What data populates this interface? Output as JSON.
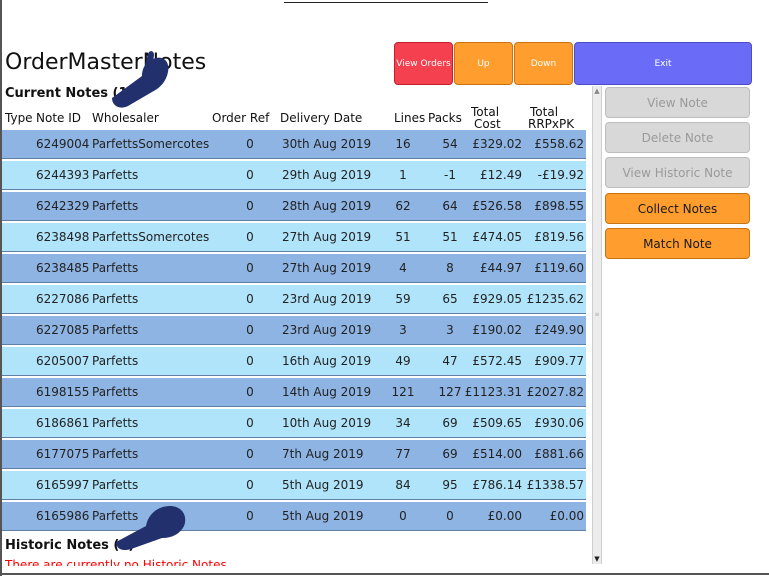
{
  "app": {
    "title": "OrderMasterNotes"
  },
  "toolbar": {
    "view_orders": "View Orders",
    "up": "Up",
    "down": "Down",
    "exit": "Exit"
  },
  "sections": {
    "current": "Current Notes (13)",
    "historic": "Historic Notes (0)",
    "historic_message": "There are currently no Historic Notes"
  },
  "table": {
    "headers": {
      "type": "Type",
      "note_id": "Note ID",
      "wholesaler": "Wholesaler",
      "order_ref": "Order Ref",
      "delivery_date": "Delivery Date",
      "lines": "Lines",
      "packs": "Packs",
      "total_cost_1": "Total",
      "total_cost_2": "Cost",
      "total_rrp_1": "Total",
      "total_rrp_2": "RRPxPK"
    },
    "rows": [
      {
        "note_id": "6249004",
        "wholesaler": "ParfettsSomercotes",
        "order_ref": "0",
        "delivery_date": "30th Aug 2019",
        "lines": "16",
        "packs": "54",
        "total_cost": "£329.02",
        "total_rrp": "£558.62"
      },
      {
        "note_id": "6244393",
        "wholesaler": "Parfetts",
        "order_ref": "0",
        "delivery_date": "29th Aug 2019",
        "lines": "1",
        "packs": "-1",
        "total_cost": "£12.49",
        "total_rrp": "-£19.92"
      },
      {
        "note_id": "6242329",
        "wholesaler": "Parfetts",
        "order_ref": "0",
        "delivery_date": "28th Aug 2019",
        "lines": "62",
        "packs": "64",
        "total_cost": "£526.58",
        "total_rrp": "£898.55"
      },
      {
        "note_id": "6238498",
        "wholesaler": "ParfettsSomercotes",
        "order_ref": "0",
        "delivery_date": "27th Aug 2019",
        "lines": "51",
        "packs": "51",
        "total_cost": "£474.05",
        "total_rrp": "£819.56"
      },
      {
        "note_id": "6238485",
        "wholesaler": "Parfetts",
        "order_ref": "0",
        "delivery_date": "27th Aug 2019",
        "lines": "4",
        "packs": "8",
        "total_cost": "£44.97",
        "total_rrp": "£119.60"
      },
      {
        "note_id": "6227086",
        "wholesaler": "Parfetts",
        "order_ref": "0",
        "delivery_date": "23rd Aug 2019",
        "lines": "59",
        "packs": "65",
        "total_cost": "£929.05",
        "total_rrp": "£1235.62"
      },
      {
        "note_id": "6227085",
        "wholesaler": "Parfetts",
        "order_ref": "0",
        "delivery_date": "23rd Aug 2019",
        "lines": "3",
        "packs": "3",
        "total_cost": "£190.02",
        "total_rrp": "£249.90"
      },
      {
        "note_id": "6205007",
        "wholesaler": "Parfetts",
        "order_ref": "0",
        "delivery_date": "16th Aug 2019",
        "lines": "49",
        "packs": "47",
        "total_cost": "£572.45",
        "total_rrp": "£909.77"
      },
      {
        "note_id": "6198155",
        "wholesaler": "Parfetts",
        "order_ref": "0",
        "delivery_date": "14th Aug 2019",
        "lines": "121",
        "packs": "127",
        "total_cost": "£1123.31",
        "total_rrp": "£2027.82"
      },
      {
        "note_id": "6186861",
        "wholesaler": "Parfetts",
        "order_ref": "0",
        "delivery_date": "10th Aug 2019",
        "lines": "34",
        "packs": "69",
        "total_cost": "£509.65",
        "total_rrp": "£930.06"
      },
      {
        "note_id": "6177075",
        "wholesaler": "Parfetts",
        "order_ref": "0",
        "delivery_date": "7th Aug 2019",
        "lines": "77",
        "packs": "69",
        "total_cost": "£514.00",
        "total_rrp": "£881.66"
      },
      {
        "note_id": "6165997",
        "wholesaler": "Parfetts",
        "order_ref": "0",
        "delivery_date": "5th Aug 2019",
        "lines": "84",
        "packs": "95",
        "total_cost": "£786.14",
        "total_rrp": "£1338.57"
      },
      {
        "note_id": "6165986",
        "wholesaler": "Parfetts",
        "order_ref": "0",
        "delivery_date": "5th Aug 2019",
        "lines": "0",
        "packs": "0",
        "total_cost": "£0.00",
        "total_rrp": "£0.00"
      }
    ]
  },
  "sidebar": {
    "view_note": "View Note",
    "delete_note": "Delete Note",
    "view_historic_note": "View Historic Note",
    "collect_notes": "Collect Notes",
    "match_note": "Match Note"
  },
  "icons": {
    "pointer": "hand-pointer-icon",
    "scroll_up": "scroll-up-arrow-icon",
    "scroll_down": "scroll-down-arrow-icon"
  },
  "colors": {
    "row_dark": "#8eb4e3",
    "row_light": "#b0e4fa",
    "orange": "#ff9d2e",
    "red": "#f54050",
    "blue": "#6a6cf8",
    "hand": "#23306e"
  }
}
